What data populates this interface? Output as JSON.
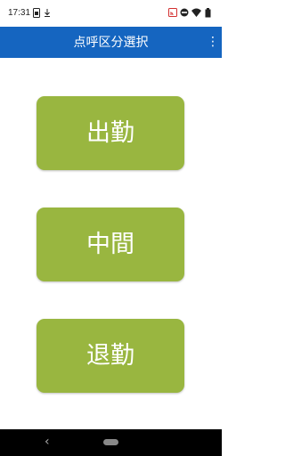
{
  "status_bar": {
    "time": "17:31",
    "left_icons": [
      "sim-icon",
      "download-icon"
    ],
    "right_icons": [
      "cast-icon",
      "dnd-icon",
      "wifi-icon",
      "battery-icon"
    ]
  },
  "app_bar": {
    "title": "点呼区分選択",
    "menu_icon": "⋮"
  },
  "buttons": [
    {
      "label": "出勤"
    },
    {
      "label": "中間"
    },
    {
      "label": "退勤"
    }
  ],
  "nav_bar": {
    "back_icon": "‹"
  },
  "colors": {
    "app_bar": "#1565c0",
    "button": "#99b640",
    "button_text": "#ffffff",
    "nav_bar": "#000000"
  }
}
